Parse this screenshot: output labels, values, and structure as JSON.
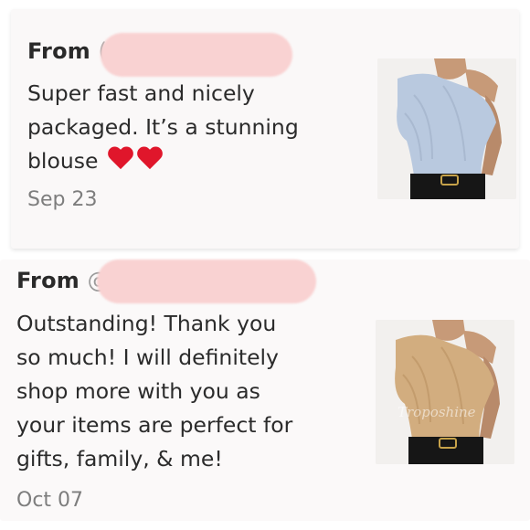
{
  "reviews": [
    {
      "from_label": "From",
      "handle_prefix": "(",
      "message_lines": [
        "Super fast and nicely",
        "packaged. It’s a stunning",
        "blouse"
      ],
      "emoji": "heart-icon",
      "date": "Sep 23",
      "product_color": "#b9c9df"
    },
    {
      "from_label": "From",
      "handle_prefix": "@",
      "message_lines": [
        "Outstanding! Thank you",
        "so much! I will definitely",
        "shop more with you as",
        "your items are perfect for",
        "gifts, family, & me!"
      ],
      "date": "Oct 07",
      "product_color": "#d2ad7f",
      "watermark": "Troposhine"
    }
  ],
  "colors": {
    "redaction": "#f9d2d2",
    "heart": "#e0162b"
  }
}
